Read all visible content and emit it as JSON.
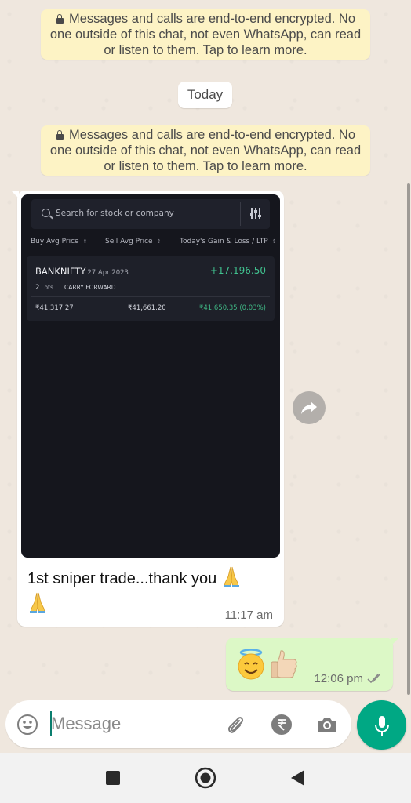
{
  "chat": {
    "encryption_notice": "Messages and calls are end-to-end encrypted. No one outside of this chat, not even WhatsApp, can read or listen to them. Tap to learn more.",
    "date_label": "Today"
  },
  "incoming_message": {
    "image": {
      "search_placeholder": "Search for stock or company",
      "columns": [
        "Buy Avg Price",
        "Sell Avg Price",
        "Today's Gain & Loss / LTP"
      ],
      "sort_glyph": "⇕",
      "position": {
        "symbol": "BANKNIFTY",
        "expiry": "27 Apr 2023",
        "pnl": "+17,196.50",
        "lots_count": "2",
        "lots_label": "Lots",
        "product": "CARRY FORWARD",
        "buy_avg": "₹41,317.27",
        "sell_avg": "₹41,661.20",
        "ltp": "₹41,650.35 (0.03%)"
      }
    },
    "caption": "1st sniper trade...thank you",
    "time": "11:17 am"
  },
  "outgoing_message": {
    "time": "12:06 pm",
    "status": "read"
  },
  "composer": {
    "placeholder": "Message",
    "icons": [
      "emoji-icon",
      "attach-icon",
      "rupee-payment-icon",
      "camera-icon",
      "mic-icon"
    ]
  },
  "colors": {
    "accent": "#00a884",
    "outgoing_bubble": "#dcf8c6",
    "notice_bg": "#fdf3c5",
    "gain_green": "#41c28f"
  }
}
